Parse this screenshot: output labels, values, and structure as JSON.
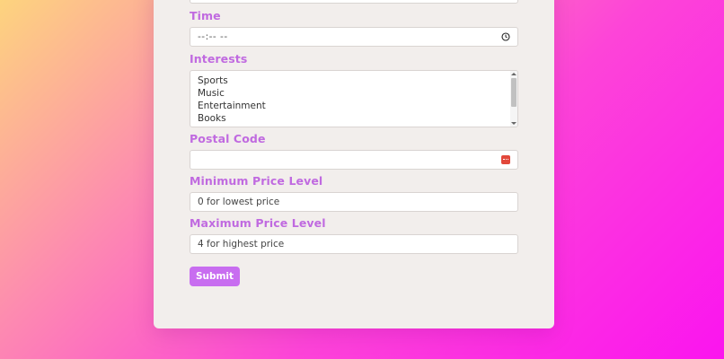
{
  "form": {
    "time": {
      "label": "Time",
      "placeholder": "--:-- --"
    },
    "interests": {
      "label": "Interests",
      "options": [
        "Sports",
        "Music",
        "Entertainment",
        "Books"
      ]
    },
    "postal_code": {
      "label": "Postal Code",
      "value": ""
    },
    "min_price": {
      "label": "Minimum Price Level",
      "placeholder": "0 for lowest price"
    },
    "max_price": {
      "label": "Maximum Price Level",
      "placeholder": "4 for highest price"
    },
    "submit_label": "Submit"
  },
  "colors": {
    "label": "#c06ae0",
    "button": "#c86df0",
    "card": "#f2eeec"
  },
  "icons": {
    "time": "clock-icon",
    "postal_code": "autofill-icon"
  }
}
